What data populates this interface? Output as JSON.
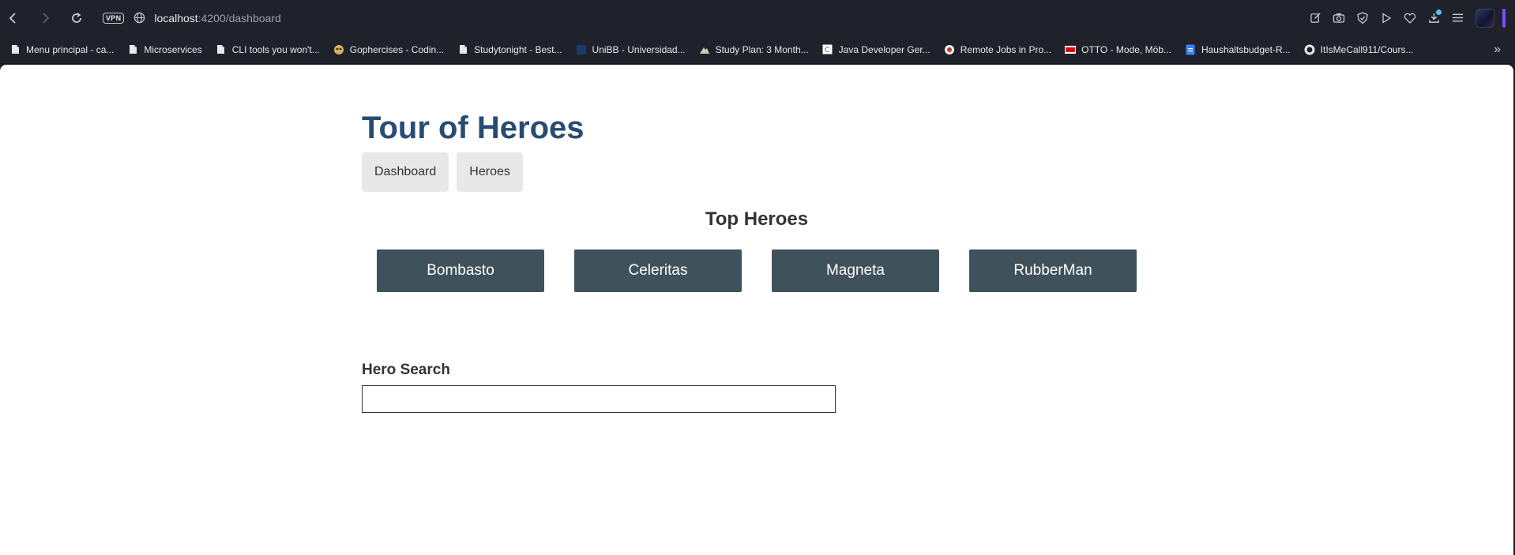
{
  "browser": {
    "vpn_label": "VPN",
    "url_host": "localhost",
    "url_path": ":4200/dashboard",
    "bookmarks": [
      {
        "label": "Menu principal - ca...",
        "icon": "page-icon"
      },
      {
        "label": "Microservices",
        "icon": "page-icon"
      },
      {
        "label": "CLI tools you won't...",
        "icon": "page-icon"
      },
      {
        "label": "Gophercises - Codin...",
        "icon": "gopher-icon"
      },
      {
        "label": "Studytonight - Best...",
        "icon": "page-icon"
      },
      {
        "label": "UniBB - Universidad...",
        "icon": "unibb-icon"
      },
      {
        "label": "Study Plan: 3 Month...",
        "icon": "mountain-icon"
      },
      {
        "label": "Java Developer Ger...",
        "icon": "c-icon"
      },
      {
        "label": "Remote Jobs in Pro...",
        "icon": "remote-icon"
      },
      {
        "label": "OTTO - Mode, Möb...",
        "icon": "otto-icon"
      },
      {
        "label": "Haushaltsbudget-R...",
        "icon": "doc-icon"
      },
      {
        "label": "ItIsMeCall911/Cours...",
        "icon": "github-icon"
      }
    ],
    "bookmarks_more": "»"
  },
  "app": {
    "title": "Tour of Heroes",
    "nav": {
      "dashboard": "Dashboard",
      "heroes": "Heroes"
    },
    "top_heroes_heading": "Top Heroes",
    "top_heroes": [
      "Bombasto",
      "Celeritas",
      "Magneta",
      "RubberMan"
    ],
    "search": {
      "label": "Hero Search",
      "value": "",
      "placeholder": ""
    }
  },
  "colors": {
    "title": "#264c73",
    "hero_card_bg": "#3f525c",
    "nav_button_bg": "#e8e8e8",
    "chrome_bg": "#1f222a"
  }
}
